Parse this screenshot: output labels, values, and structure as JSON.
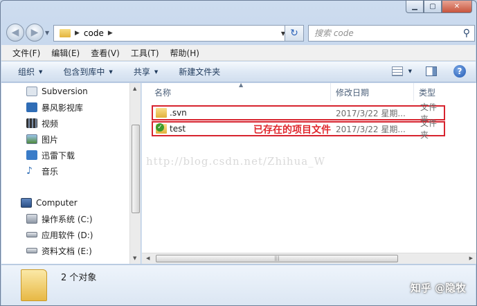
{
  "window": {
    "caption_buttons": [
      "minimize",
      "maximize",
      "close"
    ]
  },
  "address_bar": {
    "breadcrumb": "code",
    "search_placeholder": "搜索 code"
  },
  "menu": [
    "文件(F)",
    "编辑(E)",
    "查看(V)",
    "工具(T)",
    "帮助(H)"
  ],
  "toolbar": {
    "organize": "组织",
    "include_library": "包含到库中",
    "share": "共享",
    "new_folder": "新建文件夹"
  },
  "nav_pane": {
    "favorites": [
      {
        "label": "Subversion",
        "icon": "subversion-icon"
      },
      {
        "label": "暴风影视库",
        "icon": "video-library-icon"
      },
      {
        "label": "视频",
        "icon": "video-icon"
      },
      {
        "label": "图片",
        "icon": "picture-icon"
      },
      {
        "label": "迅雷下载",
        "icon": "download-icon"
      },
      {
        "label": "音乐",
        "icon": "music-icon"
      }
    ],
    "computer": "Computer",
    "drives": [
      {
        "label": "操作系统 (C:)",
        "icon": "system-drive-icon"
      },
      {
        "label": "应用软件 (D:)",
        "icon": "drive-icon"
      },
      {
        "label": "资料文档 (E:)",
        "icon": "drive-icon"
      }
    ]
  },
  "file_pane": {
    "columns": {
      "name": "名称",
      "date": "修改日期",
      "type": "类型"
    },
    "files": [
      {
        "name": ".svn",
        "date": "2017/3/22 星期...",
        "type": "文件夹",
        "icon": "folder-icon"
      },
      {
        "name": "test",
        "date": "2017/3/22 星期...",
        "type": "文件夹",
        "icon": "svn-folder-icon"
      }
    ],
    "annotation": "已存在的项目文件",
    "watermark": "http://blog.csdn.net/Zhihua_W"
  },
  "status": {
    "count": "2 个对象",
    "brand": "知乎 @隐牧"
  },
  "colors": {
    "highlight_border": "#d7232e",
    "annotation": "#e0282e",
    "toolbar_text": "#1e395b"
  }
}
